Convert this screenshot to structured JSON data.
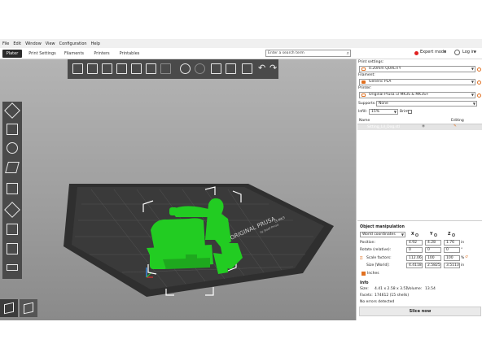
{
  "menu": [
    "File",
    "Edit",
    "Window",
    "View",
    "Configuration",
    "Help"
  ],
  "tabs": [
    "Plater",
    "Print Settings",
    "Filaments",
    "Printers",
    "Printables"
  ],
  "search": {
    "placeholder": "Enter a search term"
  },
  "mode": {
    "label": "Expert mode",
    "color": "#e02020"
  },
  "login": {
    "label": "Log in"
  },
  "toolbar_icons": [
    "add-icon",
    "delete-icon",
    "delete-all-icon",
    "arrange-icon",
    "arrange-selection-icon",
    "copy-icon",
    "paste-icon",
    "add-instance-icon",
    "remove-instance-icon",
    "split-objects-icon",
    "split-parts-icon",
    "layers-editing-icon",
    "undo-icon",
    "redo-icon"
  ],
  "left_tools": [
    "move-icon",
    "scale-icon",
    "rotate-icon",
    "place-on-face-icon",
    "cut-icon",
    "paint-supports-icon",
    "seam-painting-icon",
    "measure-icon",
    "text-icon"
  ],
  "bed": {
    "brand_text": "ORIGINAL PRUSA",
    "model_text": "i3 MK3",
    "subtext": "by Josef Prusa"
  },
  "panel": {
    "print_settings_label": "Print settings:",
    "print_settings_value": "0.20mm QUALITY",
    "filament_label": "Filament:",
    "filament_value": "Generic PLA",
    "printer_label": "Printer:",
    "printer_value": "Original Prusa i3 MK3S & MK3S+",
    "supports_label": "Supports:",
    "supports_value": "None",
    "infill_label": "Infill:",
    "infill_value": "15%",
    "brim_label": "Brim:",
    "name_header": "Name",
    "editing_header": "Editing",
    "object_name": "Sitting_Lil_Dog.stl",
    "obj_manipulation": "Object manipulation",
    "coord_system": "World coordinates",
    "axes": [
      "X",
      "Y",
      "Z"
    ],
    "position_label": "Position:",
    "position": [
      "4.92",
      "4.28",
      "1.76"
    ],
    "rotate_label": "Rotate (relative):",
    "rotate": [
      "0",
      "0",
      "0"
    ],
    "scale_label": "Scale factors:",
    "scale": [
      "112.06",
      "100",
      "100"
    ],
    "size_label": "Size [World]:",
    "size": [
      "4.4118",
      "2.5825",
      "3.5113"
    ],
    "unit_pos": "in",
    "unit_rot": "°",
    "unit_scale": "%",
    "inches_label": "Inches",
    "info_label": "Info",
    "info_size_label": "Size:",
    "info_size": "4.41 x 2.58 x 3.51",
    "volume_label": "Volume:",
    "volume": "13.54",
    "facets_label": "Facets:",
    "facets": "174612 (15 shells)",
    "errors": "No errors detected",
    "slice_button": "Slice now"
  },
  "colors": {
    "accent": "#e07020",
    "model": "#22cc22",
    "bed": "#2f2f2f"
  }
}
